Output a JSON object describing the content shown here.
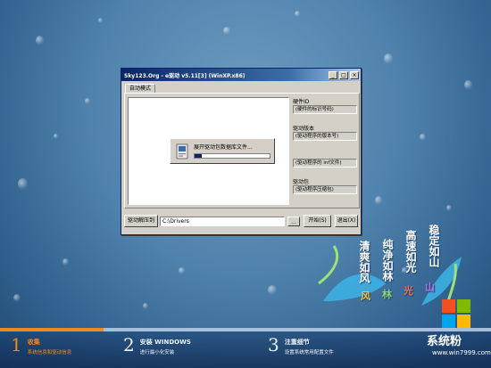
{
  "window": {
    "title": "Sky123.Org - e驱动 v5.11[3] (WinXP.x86)",
    "tab": "自动模式",
    "controls": [
      "_",
      "□",
      "×"
    ],
    "fields": [
      {
        "label": "硬件ID",
        "value": "(硬件的标识号码)"
      },
      {
        "label": "驱动版本",
        "value": "(驱动程序的版本号)"
      },
      {
        "label": "",
        "value": "(驱动程序的 inf文件)"
      },
      {
        "label": "驱动包",
        "value": "(驱动程序压缩包)"
      }
    ],
    "extract_label": "驱动解压到",
    "extract_path": "C:\\Drivers",
    "browse_label": "...",
    "start_button": "开始(S)",
    "exit_button": "退出(X)"
  },
  "progress_popup": {
    "message": "展开驱动包数据库文件...",
    "progress_fraction": 0.1
  },
  "steps": [
    {
      "number": "1",
      "title": "收集",
      "subtitle": "系统信息和驱动信息",
      "state": "active"
    },
    {
      "number": "2",
      "title": "安装 WINDOWS",
      "subtitle": "进行最小化安装",
      "state": "idle"
    },
    {
      "number": "3",
      "title": "注重细节",
      "subtitle": "设置系统常用配置文件",
      "state": "idle"
    }
  ],
  "step_progress_fraction": 0.21,
  "decor_text": [
    "清爽如风",
    "纯净如林",
    "高速如光",
    "稳定如山"
  ],
  "decor_marks": [
    "风",
    "林",
    "光",
    "山"
  ],
  "brand": {
    "name": "系统粉",
    "url": "www.win7999.com"
  },
  "colors": {
    "accent": "#f08a1c",
    "titlebar": "#0a246a"
  }
}
